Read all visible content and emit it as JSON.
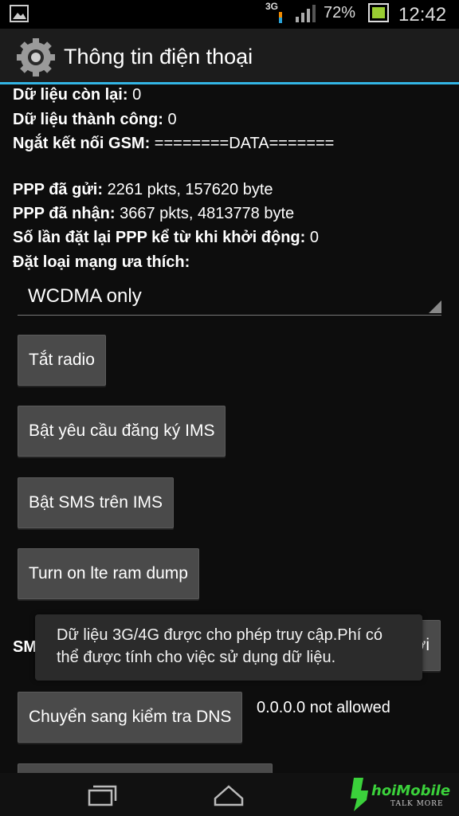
{
  "status_bar": {
    "network_type": "3G",
    "battery_percent": "72%",
    "time": "12:42"
  },
  "action_bar": {
    "title": "Thông tin điện thoại",
    "icon": "settings-gear-icon"
  },
  "info": [
    {
      "label": "Dữ liệu còn lại:",
      "value": " 0"
    },
    {
      "label": "Dữ liệu thành công:",
      "value": " 0"
    },
    {
      "label": "Ngắt kết nối GSM:",
      "value": " ========DATA======="
    },
    {
      "label": "PPP đã gửi:",
      "value": " 2261 pkts, 157620 byte"
    },
    {
      "label": "PPP đã nhận:",
      "value": " 3667 pkts, 4813778 byte"
    },
    {
      "label": "Số lần đặt lại PPP kể từ khi khởi động:",
      "value": " 0"
    },
    {
      "label": "Đặt loại mạng ưa thích:",
      "value": ""
    }
  ],
  "network_spinner": {
    "selected": "WCDMA only"
  },
  "buttons": {
    "radio": "Tắt radio",
    "ims_registration": "Bật yêu cầu đăng ký IMS",
    "sms_over_ims": "Bật SMS trên IMS",
    "lte_ram_dump": "Turn on lte ram dump",
    "dns_check": "Chuyển sang kiểm tra DNS"
  },
  "partial": {
    "sms_label": "SMS",
    "refresh_fragment": "mới"
  },
  "dns_status": "0.0.0.0 not allowed",
  "toast": {
    "message": "Dữ liệu 3G/4G được cho phép truy cập.Phí có thể được tính cho việc sử dụng dữ liệu."
  },
  "watermark": {
    "brand": "hoiMobile",
    "tagline": "TALK MORE"
  }
}
